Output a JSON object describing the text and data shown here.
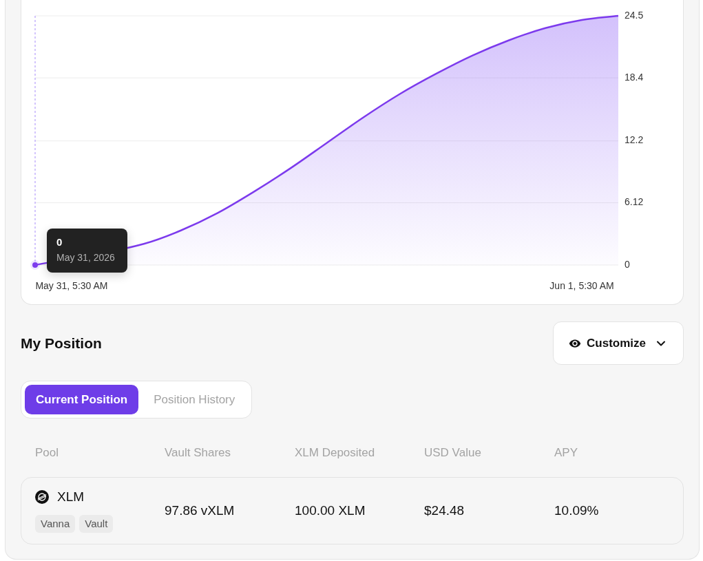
{
  "chart": {
    "chart_data": {
      "type": "area",
      "grid": true,
      "categories": [
        null,
        "May 31, 5:30 AM",
        null,
        null,
        null,
        null,
        null,
        null,
        null,
        null,
        null,
        null,
        null,
        null,
        null,
        "Jun 1, 5:30 AM",
        null
      ],
      "ylim": [
        0,
        24.5
      ],
      "yticks": [
        0,
        6.12,
        12.2,
        18.4,
        24.5
      ],
      "series": [
        {
          "color": "#7c3aed",
          "values": [
            0,
            null,
            null,
            2.1,
            3.4,
            5.1,
            7.2,
            9.5,
            12.0,
            14.5,
            16.8,
            18.8,
            20.6,
            22.1,
            23.3,
            24.1,
            24.5
          ]
        }
      ]
    },
    "tooltip": {
      "value": "0",
      "date": "May 31, 2026"
    }
  },
  "section_title": "My Position",
  "customize_button": {
    "label": "Customize"
  },
  "tabs": [
    {
      "label": "Current Position",
      "selected": true
    },
    {
      "label": "Position History",
      "selected": false
    }
  ],
  "table": {
    "columns": [
      "Pool",
      "Vault Shares",
      "XLM Deposited",
      "USD Value",
      "APY"
    ],
    "rows": [
      {
        "pool": "XLM",
        "tags": [
          "Vanna",
          "Vault"
        ],
        "vault_shares": "97.86 vXLM",
        "xlm_deposited": "100.00 XLM",
        "usd_value": "$24.48",
        "apy": "10.09%"
      }
    ]
  }
}
